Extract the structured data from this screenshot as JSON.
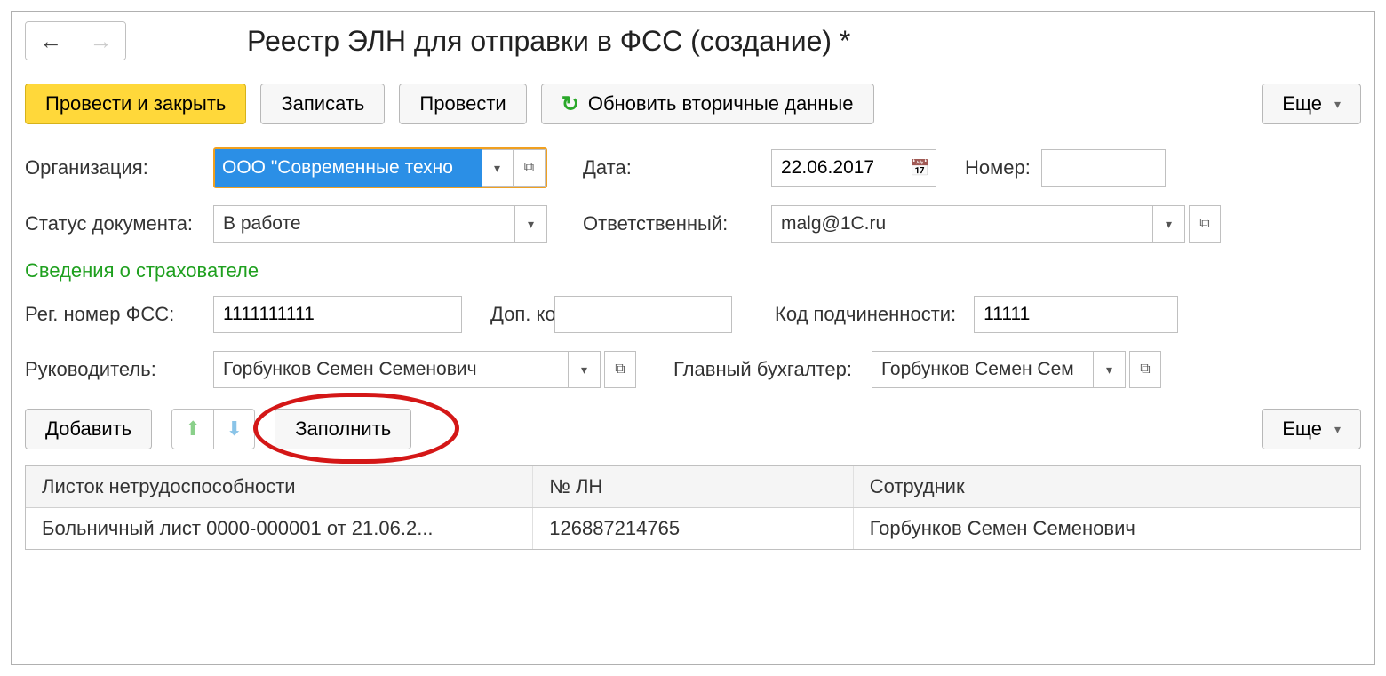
{
  "header": {
    "title": "Реестр ЭЛН для отправки в ФСС (создание) *"
  },
  "toolbar": {
    "post_close": "Провести и закрыть",
    "save": "Записать",
    "post": "Провести",
    "refresh": "Обновить вторичные данные",
    "more": "Еще"
  },
  "form": {
    "org_label": "Организация:",
    "org_value": "ООО \"Современные техно",
    "date_label": "Дата:",
    "date_value": "22.06.2017",
    "number_label": "Номер:",
    "number_value": "",
    "status_label": "Статус документа:",
    "status_value": "В работе",
    "responsible_label": "Ответственный:",
    "responsible_value": "malg@1C.ru"
  },
  "insurer": {
    "section": "Сведения о страхователе",
    "reg_label": "Рег. номер ФСС:",
    "reg_value": "1111111111",
    "ext_label": "Доп. код:",
    "ext_value": "",
    "subcode_label": "Код подчиненности:",
    "subcode_value": "11111",
    "head_label": "Руководитель:",
    "head_value": "Горбунков Семен Семенович",
    "acct_label": "Главный бухгалтер:",
    "acct_value": "Горбунков Семен Сем"
  },
  "table_toolbar": {
    "add": "Добавить",
    "fill": "Заполнить",
    "more": "Еще"
  },
  "table": {
    "columns": [
      "Листок нетрудоспособности",
      "№ ЛН",
      "Сотрудник"
    ],
    "rows": [
      {
        "doc": "Больничный лист 0000-000001 от 21.06.2...",
        "num": "126887214765",
        "emp": "Горбунков Семен Семенович"
      }
    ]
  }
}
